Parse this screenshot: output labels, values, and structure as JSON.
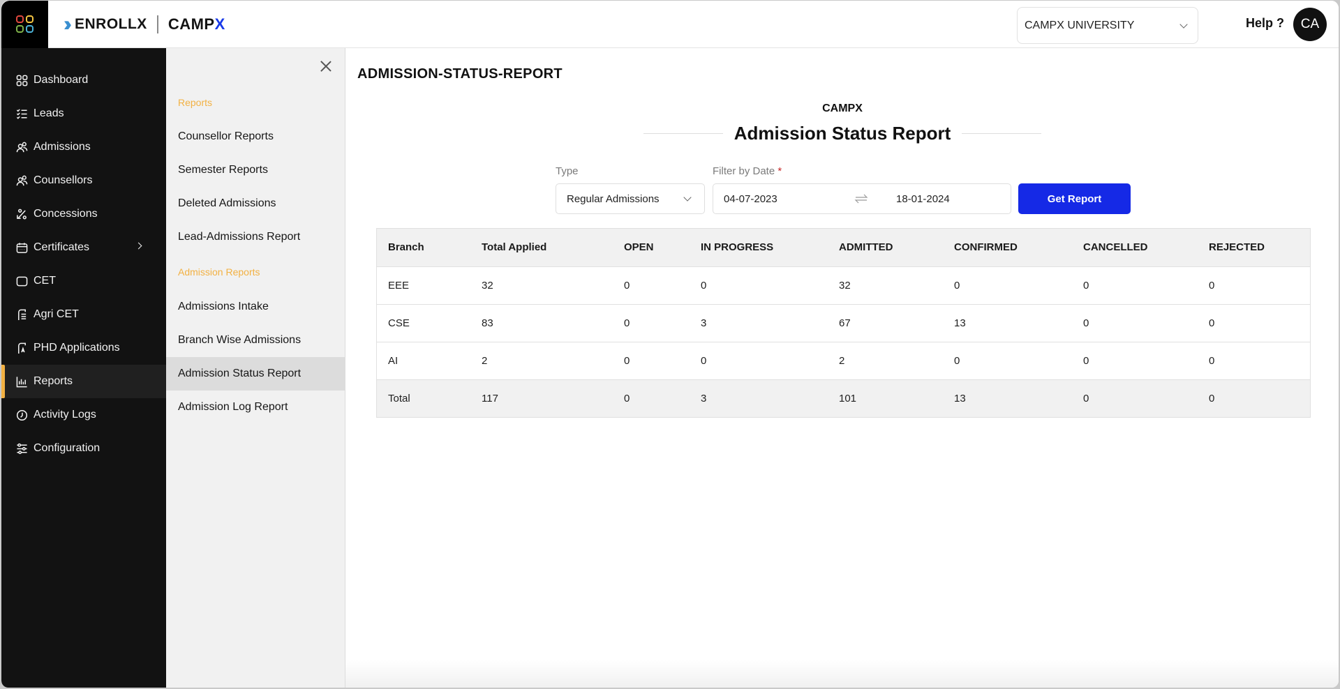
{
  "header": {
    "brand_primary": "ENROLLX",
    "brand_secondary": "CAMP",
    "brand_secondary_accent": "X",
    "institution_select": "CAMPX UNIVERSITY",
    "help_label": "Help ?",
    "avatar_initials": "CA"
  },
  "colors": {
    "accent_orange": "#f2b143",
    "primary_blue": "#1529e6",
    "sidebar_bg": "#121212",
    "logo_dots": [
      "#e0483e",
      "#f5c542",
      "#7fb24a",
      "#4cb3d8"
    ]
  },
  "sidebar": {
    "items": [
      {
        "label": "Dashboard",
        "icon": "grid-icon"
      },
      {
        "label": "Leads",
        "icon": "checklist-icon"
      },
      {
        "label": "Admissions",
        "icon": "users-icon"
      },
      {
        "label": "Counsellors",
        "icon": "users-icon"
      },
      {
        "label": "Concessions",
        "icon": "percent-icon"
      },
      {
        "label": "Certificates",
        "icon": "calendar-icon",
        "has_submenu": true
      },
      {
        "label": "CET",
        "icon": "square-icon"
      },
      {
        "label": "Agri CET",
        "icon": "document-icon"
      },
      {
        "label": "PHD Applications",
        "icon": "document-a-icon"
      },
      {
        "label": "Reports",
        "icon": "bar-chart-icon",
        "active": true
      },
      {
        "label": "Activity Logs",
        "icon": "clock-icon"
      },
      {
        "label": "Configuration",
        "icon": "sliders-icon"
      }
    ]
  },
  "subnav": {
    "section_reports": "Reports",
    "reports_items": [
      "Counsellor Reports",
      "Semester Reports",
      "Deleted Admissions",
      "Lead-Admissions Report"
    ],
    "section_admission_reports": "Admission Reports",
    "admission_items": [
      "Admissions Intake",
      "Branch Wise Admissions",
      "Admission Status Report",
      "Admission Log Report"
    ],
    "active_item": "Admission Status Report"
  },
  "main": {
    "page_title": "ADMISSION-STATUS-REPORT",
    "report_org": "CAMPX",
    "report_title": "Admission Status Report",
    "type_label": "Type",
    "type_value": "Regular Admissions",
    "date_label": "Filter by Date",
    "date_required": "*",
    "date_from": "04-07-2023",
    "date_to": "18-01-2024",
    "get_report_label": "Get Report"
  },
  "table": {
    "columns": [
      "Branch",
      "Total Applied",
      "OPEN",
      "IN PROGRESS",
      "ADMITTED",
      "CONFIRMED",
      "CANCELLED",
      "REJECTED"
    ],
    "rows": [
      [
        "EEE",
        "32",
        "0",
        "0",
        "32",
        "0",
        "0",
        "0"
      ],
      [
        "CSE",
        "83",
        "0",
        "3",
        "67",
        "13",
        "0",
        "0"
      ],
      [
        "AI",
        "2",
        "0",
        "0",
        "2",
        "0",
        "0",
        "0"
      ]
    ],
    "total_row": [
      "Total",
      "117",
      "0",
      "3",
      "101",
      "13",
      "0",
      "0"
    ]
  }
}
